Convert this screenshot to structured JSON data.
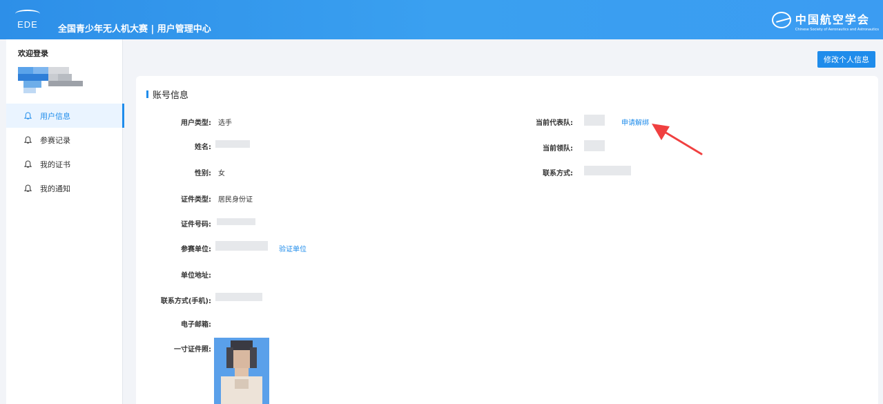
{
  "header": {
    "logo_text": "EDE",
    "title": "全国青少年无人机大赛 | 用户管理中心",
    "org_name": "中国航空学会",
    "org_subtitle": "Chinese Society of Aeronautics and Astronautics",
    "background": "#2d8fe8"
  },
  "sidebar": {
    "welcome": "欢迎登录",
    "items": [
      {
        "label": "用户信息",
        "active": true,
        "icon": "bell-icon"
      },
      {
        "label": "参赛记录",
        "active": false,
        "icon": "bell-icon"
      },
      {
        "label": "我的证书",
        "active": false,
        "icon": "bell-icon"
      },
      {
        "label": "我的通知",
        "active": false,
        "icon": "bell-icon"
      }
    ]
  },
  "toolbar": {
    "edit_profile_label": "修改个人信息"
  },
  "account": {
    "section_title": "账号信息",
    "left": {
      "user_type_label": "用户类型:",
      "user_type_value": "选手",
      "name_label": "姓名:",
      "gender_label": "性别:",
      "gender_value": "女",
      "id_type_label": "证件类型:",
      "id_type_value": "居民身份证",
      "id_number_label": "证件号码:",
      "unit_label": "参赛单位:",
      "verify_unit_link": "验证单位",
      "unit_address_label": "单位地址:",
      "phone_label": "联系方式(手机):",
      "email_label": "电子邮箱:",
      "photo_label": "一寸证件照:"
    },
    "right": {
      "team_label": "当前代表队:",
      "unbind_link": "申请解绑",
      "leader_label": "当前领队:",
      "contact_label": "联系方式:"
    }
  },
  "colors": {
    "accent": "#1f8ceb",
    "annotation_arrow": "#f04040"
  }
}
